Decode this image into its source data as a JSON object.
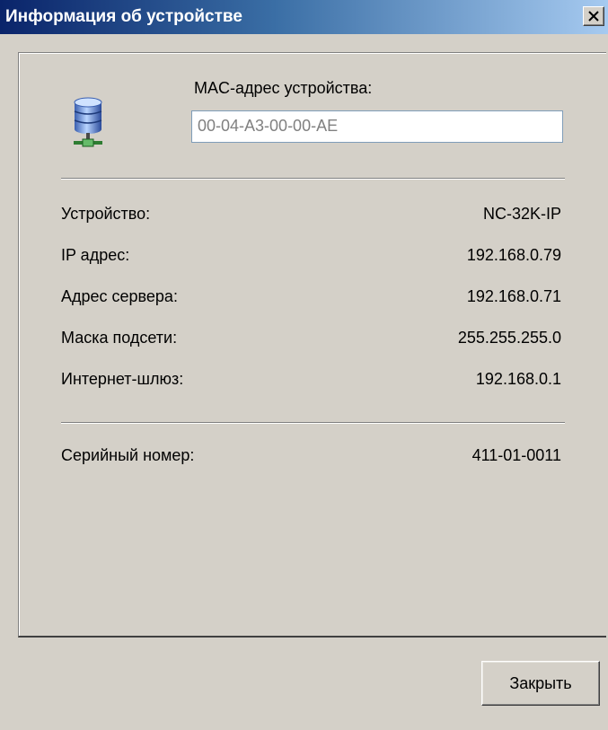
{
  "window": {
    "title": "Информация об устройстве",
    "close_icon": "close-icon"
  },
  "device": {
    "icon": "network-device-icon",
    "mac_label": "MAC-адрес устройства:",
    "mac_value": "00-04-A3-00-00-AE"
  },
  "info_rows": [
    {
      "label": "Устройство:",
      "value": "NC-32K-IP"
    },
    {
      "label": "IP адрес:",
      "value": "192.168.0.79"
    },
    {
      "label": "Адрес сервера:",
      "value": "192.168.0.71"
    },
    {
      "label": "Маска подсети:",
      "value": "255.255.255.0"
    },
    {
      "label": "Интернет-шлюз:",
      "value": "192.168.0.1"
    }
  ],
  "serial": {
    "label": "Серийный номер:",
    "value": "411-01-0011"
  },
  "buttons": {
    "close_label": "Закрыть"
  },
  "colors": {
    "titlebar_start": "#0a246a",
    "titlebar_end": "#a6caf0",
    "window_bg": "#d4d0c8"
  }
}
